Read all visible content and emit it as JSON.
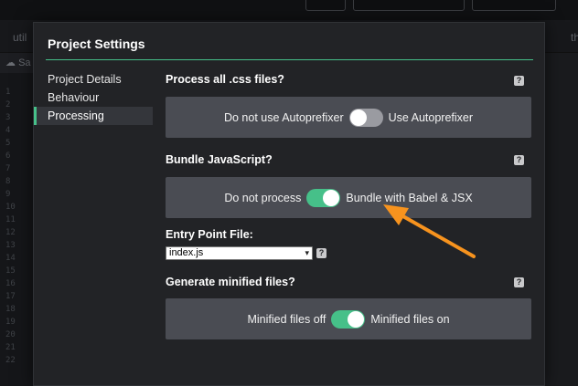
{
  "editor": {
    "tabs": [
      "util",
      "th"
    ],
    "save_label": "Sa",
    "line_numbers": [
      "1",
      "2",
      "3",
      "4",
      "5",
      "6",
      "7",
      "8",
      "9",
      "10",
      "11",
      "12",
      "13",
      "14",
      "15",
      "16",
      "17",
      "18",
      "19",
      "20",
      "21",
      "22"
    ]
  },
  "modal": {
    "title": "Project Settings",
    "nav": [
      {
        "label": "Project Details",
        "active": false
      },
      {
        "label": "Behaviour",
        "active": false
      },
      {
        "label": "Processing",
        "active": true
      }
    ],
    "help_glyph": "?",
    "css": {
      "label": "Process all .css files?",
      "off_label": "Do not use Autoprefixer",
      "on_label": "Use Autoprefixer",
      "enabled": false
    },
    "js": {
      "label": "Bundle JavaScript?",
      "off_label": "Do not process",
      "on_label": "Bundle with Babel & JSX",
      "enabled": true
    },
    "entry": {
      "label": "Entry Point File:",
      "value": "index.js",
      "caret": "▾"
    },
    "minify": {
      "label": "Generate minified files?",
      "off_label": "Minified files off",
      "on_label": "Minified files on",
      "enabled": true
    }
  },
  "colors": {
    "accent": "#46c089",
    "annotation_arrow": "#f7931e"
  }
}
